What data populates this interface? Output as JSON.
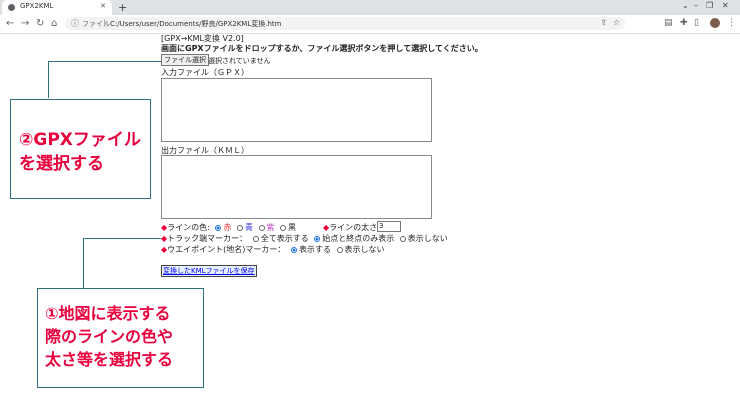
{
  "browser": {
    "tab_title": "GPX2KML",
    "new_tab_glyph": "+",
    "url_prefix": "ファイル",
    "url": "C:/Users/user/Documents/野良/GPX2KML変換.htm"
  },
  "page": {
    "title": "[GPX→KML変換 V2.0]",
    "instruction": "画面にGPXファイルをドロップするか、ファイル選択ボタンを押して選択してください。",
    "file_button": "ファイル選択",
    "no_file": "選択されていません",
    "input_label": "入力ファイル（ＧＰＸ）",
    "output_label": "出力ファイル（ＫＭＬ）",
    "marker": "◆",
    "line_color": {
      "label": "ラインの色:",
      "options": [
        "赤",
        "青",
        "紫",
        "黒"
      ],
      "selected": "赤"
    },
    "line_width": {
      "label": "ラインの太さ:",
      "value": "3"
    },
    "track_marker": {
      "label": "トラック端マーカー：",
      "options": [
        "全て表示する",
        "始点と終点のみ表示",
        "表示しない"
      ],
      "selected": "始点と終点のみ表示"
    },
    "waypoint_marker": {
      "label": "ウエイポイント(地名)マーカー：",
      "options": [
        "表示する",
        "表示しない"
      ],
      "selected": "表示する"
    },
    "save_button": "変換したKMLファイルを保存"
  },
  "annotations": {
    "callout2_line1": "②GPXファイル",
    "callout2_line2": "を選択する",
    "callout1_line1": "①地図に表示する",
    "callout1_line2": "際のラインの色や",
    "callout1_line3": "太さ等を選択する"
  },
  "colors": {
    "annotation_text": "#e8003d",
    "annotation_border": "#2f6f80",
    "radio_selected": "#1a73e8"
  }
}
